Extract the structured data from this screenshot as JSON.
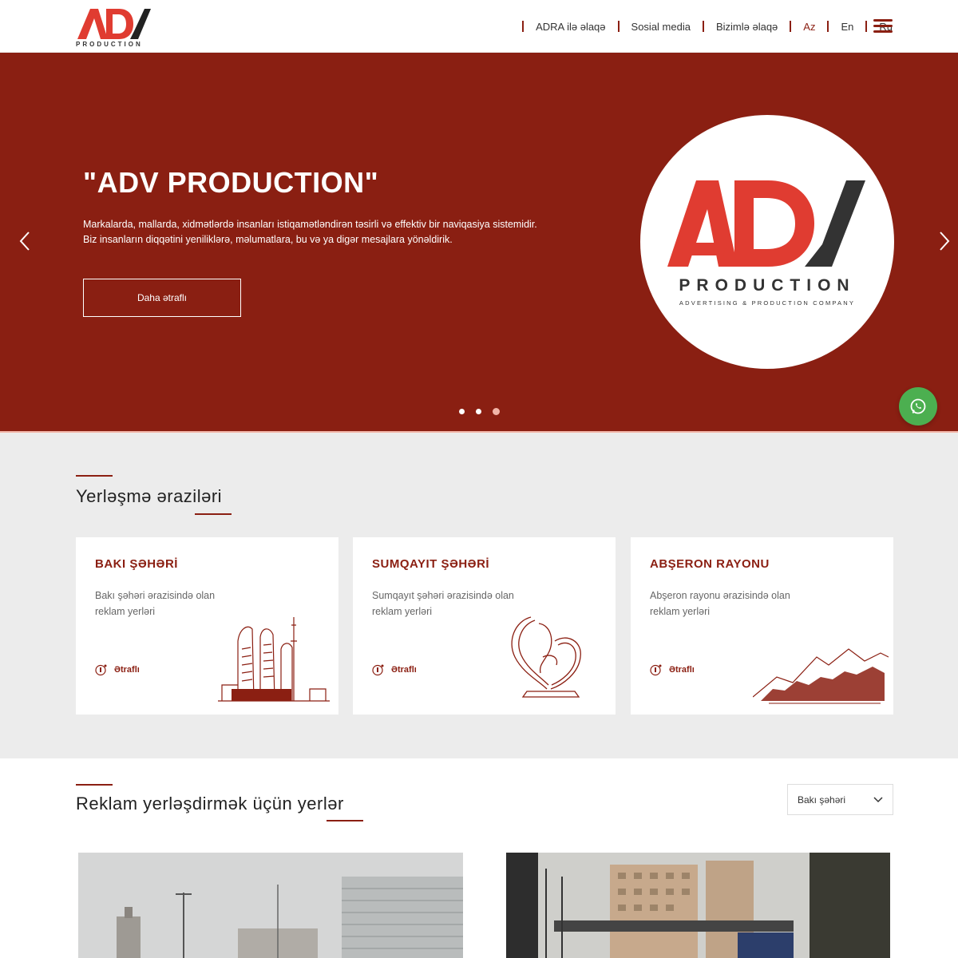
{
  "header": {
    "logo_text": "PRODUCTION",
    "nav": [
      {
        "label": "ADRA ilə əlaqə"
      },
      {
        "label": "Sosial media"
      },
      {
        "label": "Bizimlə əlaqə"
      },
      {
        "label": "Az",
        "active": true
      },
      {
        "label": "En"
      },
      {
        "label": "Ru"
      }
    ]
  },
  "hero": {
    "title": "\"ADV PRODUCTION\"",
    "text": "Markalarda, mallarda, xidmətlərdə insanları istiqamətləndirən təsirli və effektiv bir naviqasiya sistemidir. Biz insanların diqqətini yeniliklərə, məlumatlara, bu və ya digər mesajlara yönəldirik.",
    "button": "Daha ətraflı",
    "circle_logo_big": "ADV",
    "circle_logo_production": "PRODUCTION",
    "circle_logo_tagline": "ADVERTISING & PRODUCTION COMPANY",
    "slides_count": 3,
    "active_slide": 3
  },
  "areas": {
    "title": "Yerləşmə əraziləri",
    "cards": [
      {
        "title": "BAKI ŞƏHƏRİ",
        "desc": "Bakı şəhəri ərazisində olan reklam yerləri",
        "more": "Ətraflı"
      },
      {
        "title": "SUMQAYIT ŞƏHƏRİ",
        "desc": "Sumqayıt şəhəri ərazisində olan reklam yerləri",
        "more": "Ətraflı"
      },
      {
        "title": "ABŞERON RAYONU",
        "desc": "Abşeron rayonu ərazisində olan reklam yerləri",
        "more": "Ətraflı"
      }
    ]
  },
  "places": {
    "title": "Reklam yerləşdirmək üçün yerlər",
    "select_value": "Bakı şəhəri"
  },
  "colors": {
    "brand": "#8a1f12",
    "accent_light": "#f2b5a8",
    "logo_red": "#e03c31",
    "whatsapp": "#4caf50"
  }
}
